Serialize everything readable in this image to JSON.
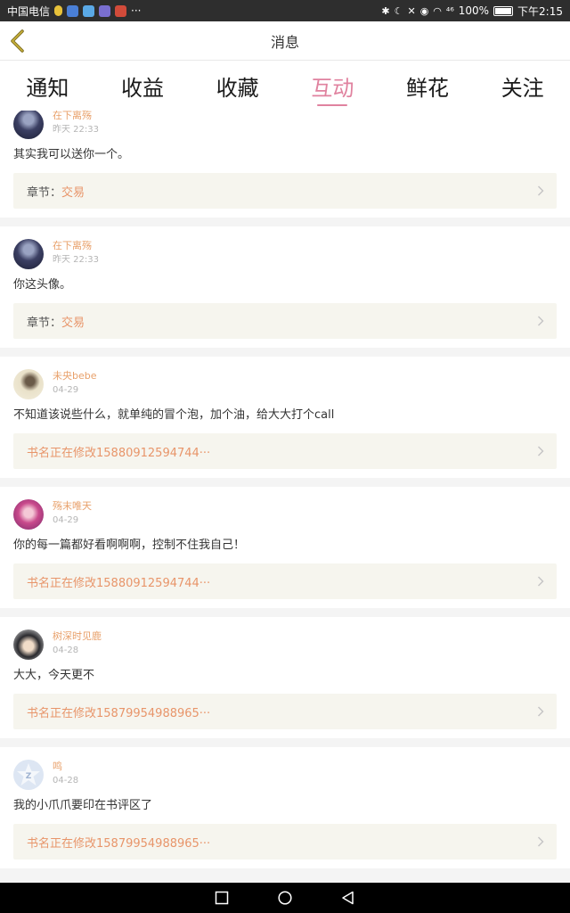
{
  "status_bar": {
    "carrier": "中国电信",
    "more": "···",
    "signal": "⁴⁶",
    "battery": "100%",
    "time": "下午2:15",
    "icons": [
      "bluetooth-icon",
      "moon-icon",
      "mute-icon",
      "eye-icon",
      "wifi-icon",
      "signal-icon",
      "battery-icon"
    ]
  },
  "header": {
    "title": "消息",
    "back_icon": "chevron-left-icon"
  },
  "tabs": [
    {
      "label": "通知",
      "active": false
    },
    {
      "label": "收益",
      "active": false
    },
    {
      "label": "收藏",
      "active": false
    },
    {
      "label": "互动",
      "active": true
    },
    {
      "label": "鲜花",
      "active": false
    },
    {
      "label": "关注",
      "active": false
    }
  ],
  "colors": {
    "accent": "#e0829f",
    "name": "#e8a06a",
    "link": "#e8956a",
    "ref_bg": "#f6f5ee"
  },
  "messages": [
    {
      "user": "在下离殇",
      "time": "昨天 22:33",
      "content": "其实我可以送你一个。",
      "ref_prefix": "章节：",
      "ref_text": "交易"
    },
    {
      "user": "在下离殇",
      "time": "昨天 22:33",
      "content": "你这头像。",
      "ref_prefix": "章节：",
      "ref_text": "交易"
    },
    {
      "user": "未央bebe",
      "time": "04-29",
      "content": "不知道该说些什么，就单纯的冒个泡，加个油，给大大打个call",
      "ref_prefix": "",
      "ref_text": "书名正在修改15880912594744···"
    },
    {
      "user": "殇末唯天",
      "time": "04-29",
      "content": "你的每一篇都好看啊啊啊，控制不住我自己！",
      "ref_prefix": "",
      "ref_text": "书名正在修改15880912594744···"
    },
    {
      "user": "树深时见鹿",
      "time": "04-28",
      "content": "大大，今天更不",
      "ref_prefix": "",
      "ref_text": "书名正在修改15879954988965···"
    },
    {
      "user": "鸣",
      "time": "04-28",
      "content": "我的小爪爪要印在书评区了",
      "ref_prefix": "",
      "ref_text": "书名正在修改15879954988965···"
    }
  ],
  "nav_bar": [
    "recents-square-icon",
    "home-circle-icon",
    "back-triangle-icon"
  ]
}
